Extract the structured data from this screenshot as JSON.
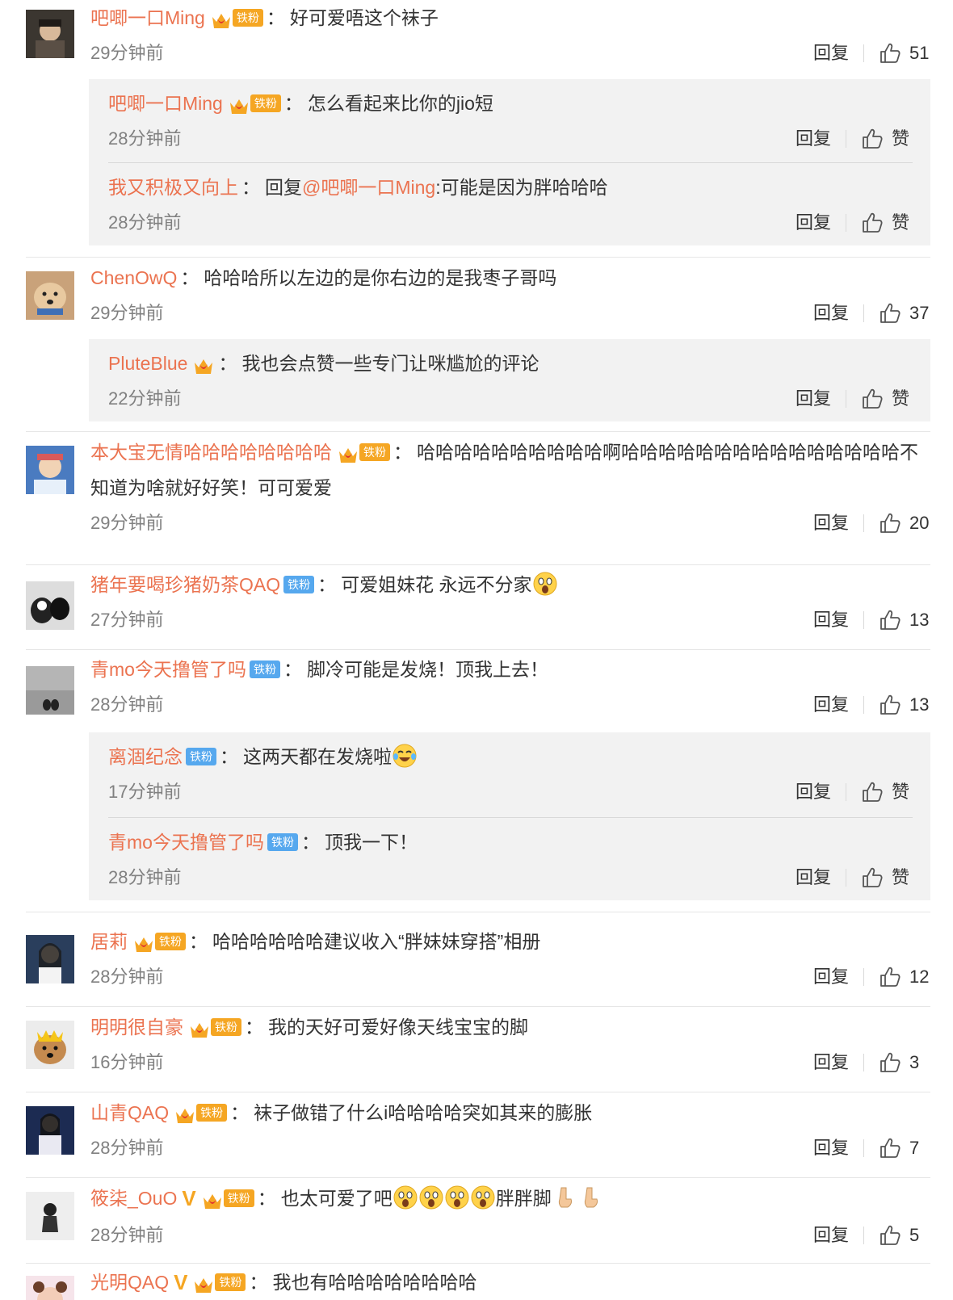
{
  "accent_color": "#eb7350",
  "fan_badge_color": "#f5a623",
  "fan_badge_blue": "#56a8ee",
  "reply_label": "回复",
  "like_label": "赞",
  "comments": [
    {
      "user": "吧唧一口Ming",
      "badge": "铁粉",
      "text": "好可爱唔这个袜子",
      "time": "29分钟前",
      "likes": "51",
      "replies": [
        {
          "user": "吧唧一口Ming",
          "badge": "铁粉",
          "text": "怎么看起来比你的jio短",
          "time": "28分钟前"
        },
        {
          "user": "我又积极又向上",
          "prefix": "回复",
          "mention": "@吧唧一口Ming",
          "text": ":可能是因为胖哈哈哈",
          "time": "28分钟前"
        }
      ]
    },
    {
      "user": "ChenOwQ",
      "text": "哈哈哈所以左边的是你右边的是我枣子哥吗",
      "time": "29分钟前",
      "likes": "37",
      "replies": [
        {
          "user": "PluteBlue",
          "text": "我也会点赞一些专门让咪尴尬的评论",
          "time": "22分钟前"
        }
      ]
    },
    {
      "user": "本大宝无情哈哈哈哈哈哈哈哈",
      "badge": "铁粉",
      "text": "哈哈哈哈哈哈哈哈哈哈啊哈哈哈哈哈哈哈哈哈哈哈哈哈哈哈不知道为啥就好好笑！可可爱爱",
      "time": "29分钟前",
      "likes": "20"
    },
    {
      "user": "猪年要喝珍猪奶茶QAQ",
      "badge": "铁粉",
      "text": "可爱姐妹花 永远不分家",
      "time": "27分钟前",
      "likes": "13"
    },
    {
      "user": "青mo今天撸管了吗",
      "badge": "铁粉",
      "text": "脚冷可能是发烧！顶我上去！",
      "time": "28分钟前",
      "likes": "13",
      "replies": [
        {
          "user": "离涸纪念",
          "badge": "铁粉",
          "text": "这两天都在发烧啦",
          "time": "17分钟前"
        },
        {
          "user": "青mo今天撸管了吗",
          "badge": "铁粉",
          "text": "顶我一下！",
          "time": "28分钟前"
        }
      ]
    },
    {
      "user": "居莉",
      "badge": "铁粉",
      "text": "哈哈哈哈哈哈建议收入“胖妹妹穿搭”相册",
      "time": "28分钟前",
      "likes": "12"
    },
    {
      "user": "明明很自豪",
      "badge": "铁粉",
      "text": "我的天好可爱好像天线宝宝的脚",
      "time": "16分钟前",
      "likes": "3"
    },
    {
      "user": "山青QAQ",
      "badge": "铁粉",
      "text": "袜子做错了什么i哈哈哈哈突如其来的膨胀",
      "time": "28分钟前",
      "likes": "7"
    },
    {
      "user": "筱柒_OuO",
      "badge": "铁粉",
      "text": "也太可爱了吧",
      "text2": "胖胖脚",
      "time": "28分钟前",
      "likes": "5"
    },
    {
      "user": "光明QAQ",
      "badge": "铁粉",
      "text": "我也有哈哈哈哈哈哈哈哈"
    }
  ]
}
